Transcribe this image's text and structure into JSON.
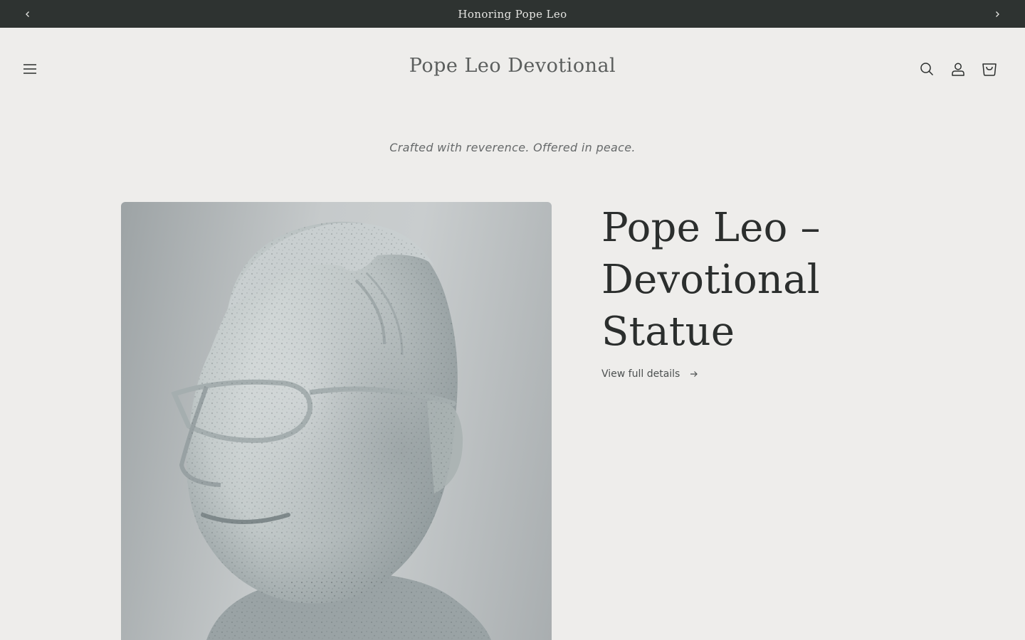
{
  "announcement": {
    "text": "Honoring Pope Leo",
    "prev_icon": "chevron-left-icon",
    "next_icon": "chevron-right-icon",
    "background": "#2e3331"
  },
  "header": {
    "brand": "Pope Leo Devotional",
    "menu_icon": "hamburger-menu-icon",
    "search_icon": "search-icon",
    "account_icon": "account-icon",
    "cart_icon": "cart-icon"
  },
  "tagline": "Crafted with reverence. Offered in peace.",
  "product": {
    "title": "Pope Leo – Devotional Statue",
    "view_details": "View full details",
    "arrow_icon": "arrow-right-icon",
    "image": "statue-bust-image"
  },
  "colors": {
    "page_background": "#eeedeb",
    "text": "#2b2e2d"
  }
}
